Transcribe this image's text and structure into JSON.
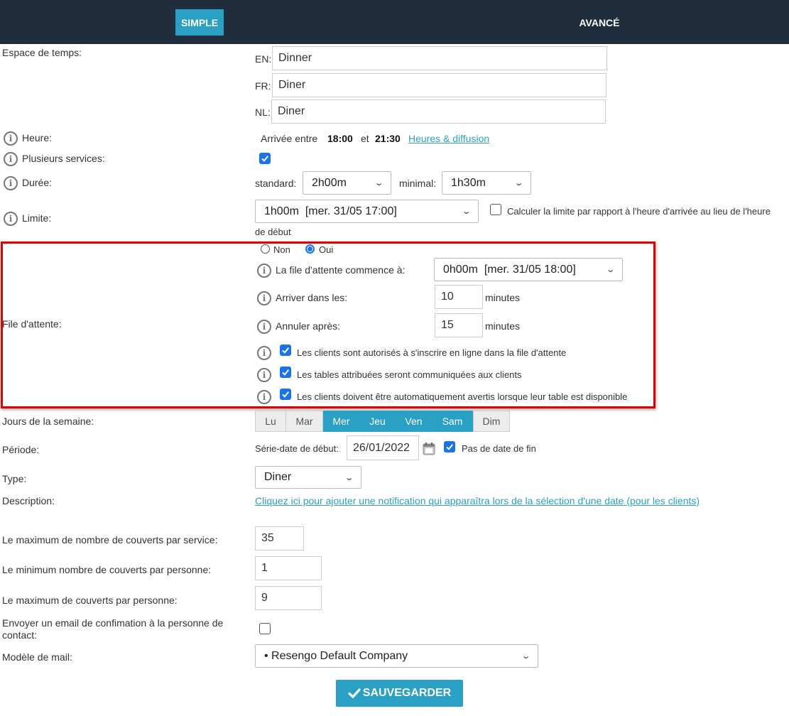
{
  "tabs": {
    "simple": "SIMPLE",
    "advanced": "AVANCÉ"
  },
  "time_space": {
    "label": "Espace de temps:",
    "languages": [
      {
        "code": "EN:",
        "value": "Dinner"
      },
      {
        "code": "FR:",
        "value": "Diner"
      },
      {
        "code": "NL:",
        "value": "Diner"
      }
    ]
  },
  "hour": {
    "label": "Heure:",
    "prefix": "Arrivée entre",
    "from": "18:00",
    "and": "et",
    "to": "21:30",
    "link": "Heures & diffusion"
  },
  "multiple_services": {
    "label": "Plusieurs services:",
    "checked": true
  },
  "duration": {
    "label": "Durée:",
    "standard_label": "standard:",
    "standard_value": "2h00m",
    "minimal_label": "minimal:",
    "minimal_value": "1h30m"
  },
  "limit": {
    "label": "Limite:",
    "value": "1h00m  [mer. 31/05 17:00]",
    "checkbox_label": "Calculer la limite par rapport à l'heure d'arrivée au lieu de l'heure",
    "checkbox_label_cont": "de début",
    "checked": false
  },
  "waitlist": {
    "label": "File d'attente:",
    "radio_no": "Non",
    "radio_yes": "Oui",
    "selected": "Oui",
    "starts_label": "La file d'attente commence à:",
    "starts_value": "0h00m  [mer. 31/05 18:00]",
    "arrive_label": "Arriver dans les:",
    "arrive_value": "10",
    "arrive_unit": "minutes",
    "cancel_label": "Annuler après:",
    "cancel_value": "15",
    "cancel_unit": "minutes",
    "options": [
      {
        "label": "Les clients sont autorisés à s'inscrire en ligne dans la file d'attente",
        "checked": true
      },
      {
        "label": "Les tables attribuées seront communiquées aux clients",
        "checked": true
      },
      {
        "label": "Les clients doivent être automatiquement avertis lorsque leur table est disponible",
        "checked": true
      }
    ]
  },
  "weekdays": {
    "label": "Jours de la semaine:",
    "days": [
      {
        "label": "Lu",
        "active": false
      },
      {
        "label": "Mar",
        "active": false
      },
      {
        "label": "Mer",
        "active": true
      },
      {
        "label": "Jeu",
        "active": true
      },
      {
        "label": "Ven",
        "active": true
      },
      {
        "label": "Sam",
        "active": true
      },
      {
        "label": "Dim",
        "active": false
      }
    ]
  },
  "period": {
    "label": "Période:",
    "start_label": "Série-date de début:",
    "start_value": "26/01/2022",
    "no_end_label": "Pas de date de fin",
    "no_end_checked": true
  },
  "type": {
    "label": "Type:",
    "value": "Diner"
  },
  "description": {
    "label": "Description:",
    "link": "Cliquez ici pour ajouter une notification qui apparaîtra lors de la sélection d'une date (pour les clients)"
  },
  "max_covers_service": {
    "label": "Le maximum de nombre de couverts par service:",
    "value": "35"
  },
  "min_covers_person": {
    "label": "Le minimum nombre de couverts par personne:",
    "value": "1"
  },
  "max_covers_person": {
    "label": "Le maximum de couverts par personne:",
    "value": "9"
  },
  "confirmation_email": {
    "label_line1": "Envoyer un email de confimation à la personne de",
    "label_line2": "contact:",
    "checked": false
  },
  "mail_template": {
    "label": "Modèle de mail:",
    "value": "• Resengo Default Company"
  },
  "save_button": {
    "label": "SAUVEGARDER"
  },
  "colors": {
    "accent": "#2aa0c5",
    "topbar": "#1f2d3d",
    "highlight_border": "#e00000",
    "checkbox": "#1a73e8"
  }
}
